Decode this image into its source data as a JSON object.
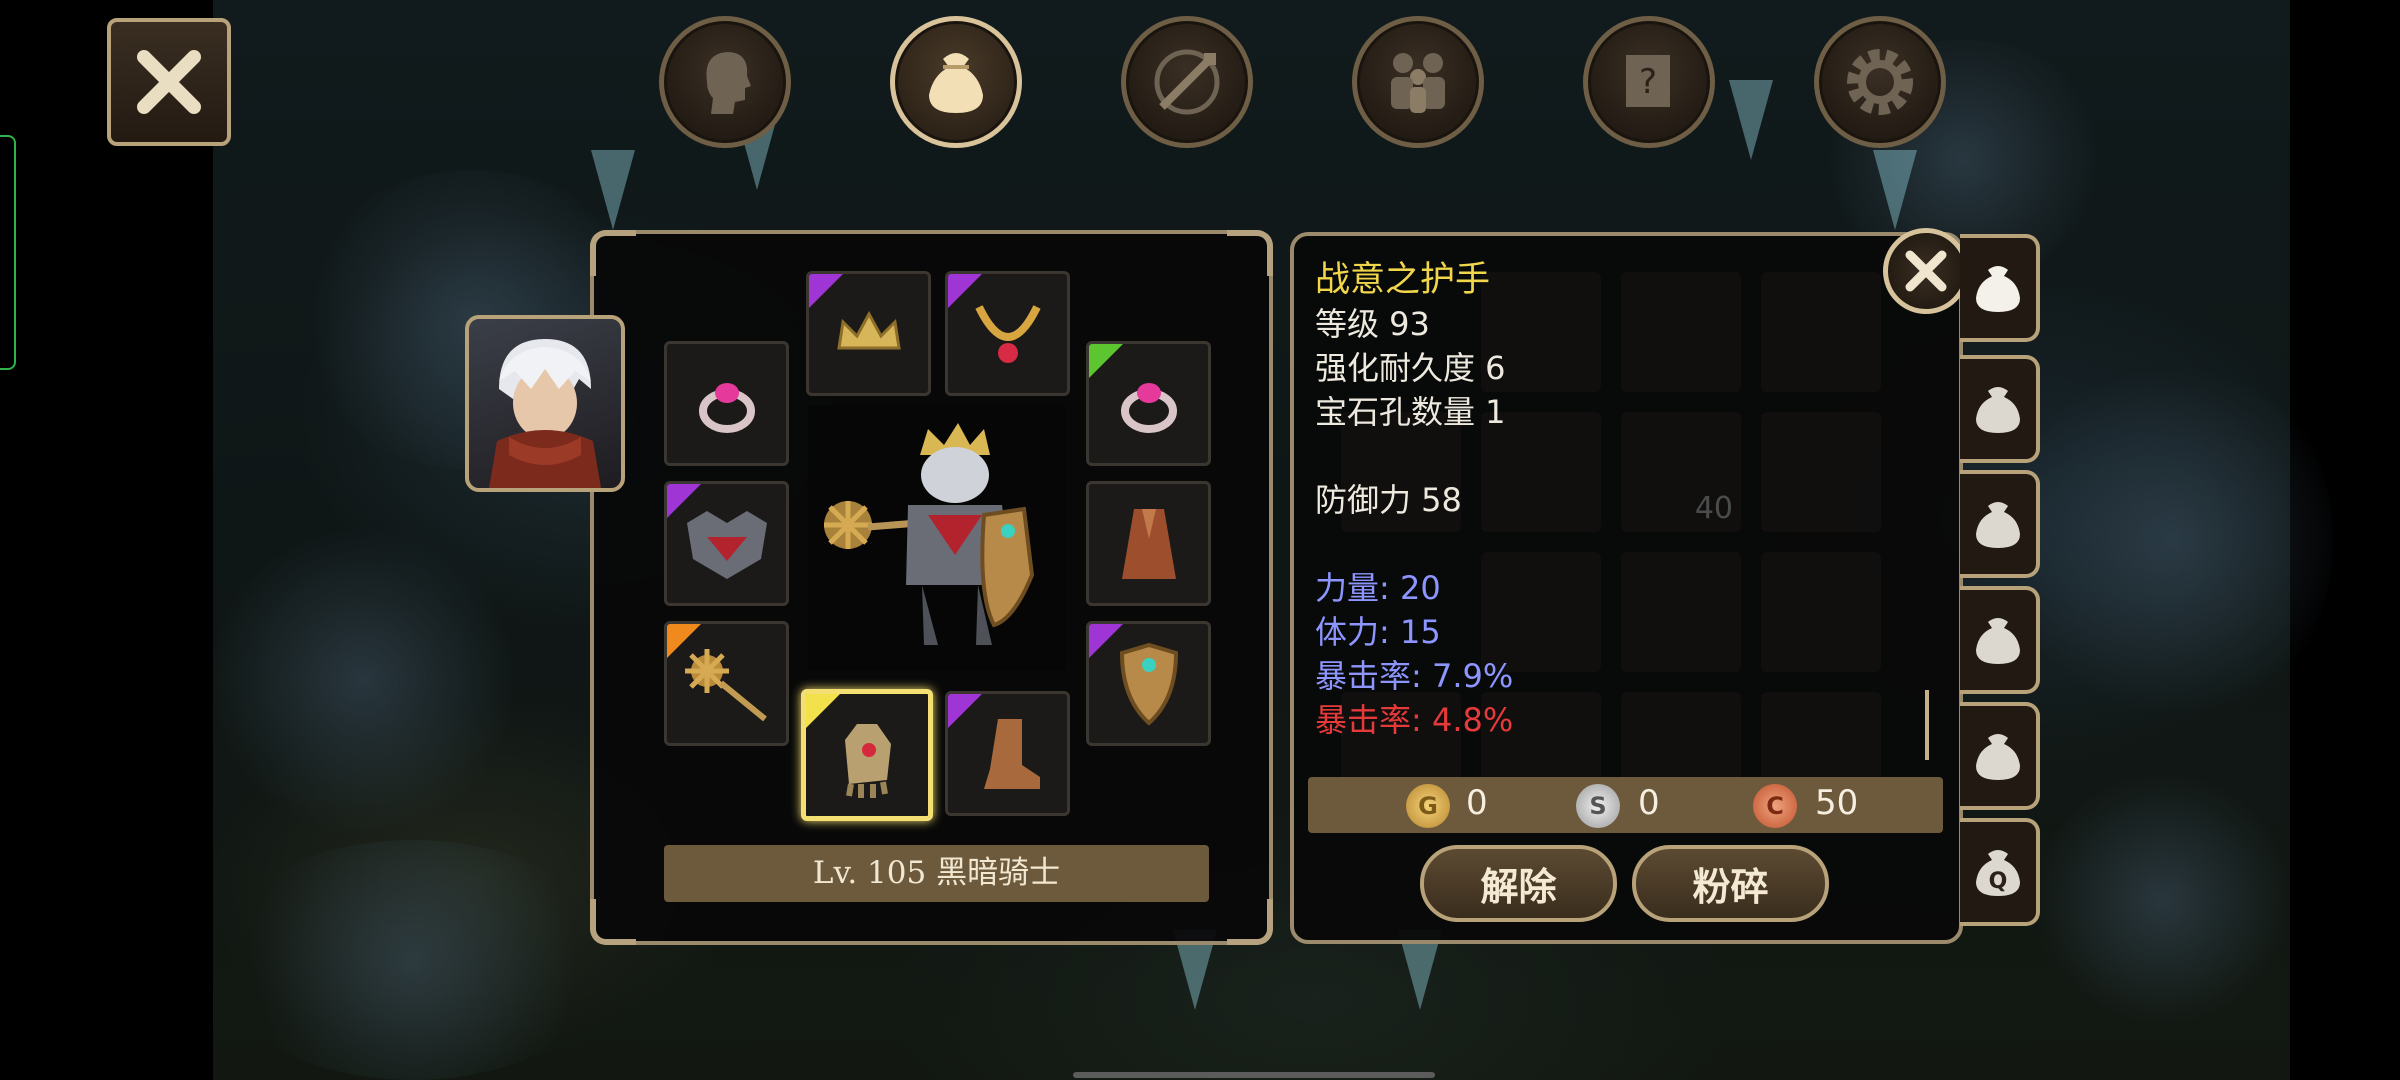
{
  "item": {
    "name": "战意之护手",
    "level": "等级 93",
    "durability": "强化耐久度 6",
    "gem_slots": "宝石孔数量 1",
    "defense": "防御力 58",
    "bonus_1": "力量: 20",
    "bonus_2": "体力: 15",
    "bonus_3": "暴击率: 7.9%",
    "bonus_4": "暴击率: 4.8%"
  },
  "character": {
    "class_label": "Lv. 105 黑暗骑士"
  },
  "currency": {
    "gold_symbol": "G",
    "gold": "0",
    "silver_symbol": "S",
    "silver": "0",
    "copper_symbol": "C",
    "copper": "50"
  },
  "buttons": {
    "unequip": "解除",
    "smash": "粉碎"
  },
  "ghost_count": "40",
  "last_tab_letter": "Q",
  "colors": {
    "item_name": "#f1d64b",
    "bonus_blue": "#8d95ff",
    "bonus_red": "#e53a3a",
    "frame": "#b8a27a",
    "bar": "#6d5a3c"
  },
  "icons": {
    "top": [
      "head-icon",
      "bag-icon",
      "compass-sword-icon",
      "party-icon",
      "quest-scroll-icon",
      "settings-gear-icon"
    ],
    "rarity": [
      "purple",
      "purple",
      "green",
      "purple",
      "orange",
      "purple",
      "yellow",
      "purple"
    ]
  }
}
